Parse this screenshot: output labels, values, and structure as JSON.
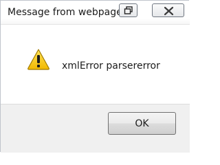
{
  "window": {
    "title": "Message from webpage"
  },
  "title_buttons": {
    "restore_icon": "restore-icon",
    "close_icon": "close-icon"
  },
  "dialog": {
    "icon": "warning-icon",
    "icon_color": "#f4c400",
    "message": "xmlError parsererror"
  },
  "footer": {
    "ok_label": "OK"
  }
}
